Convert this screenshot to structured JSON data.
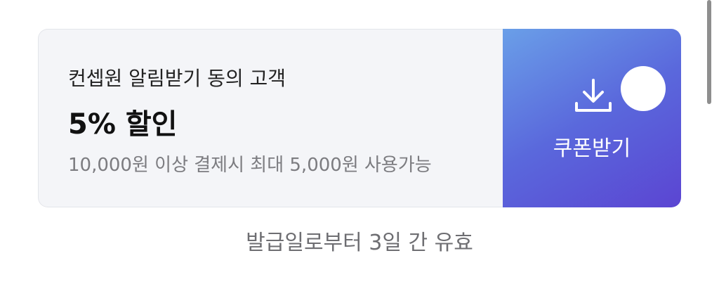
{
  "coupon": {
    "condition": "컨셉원 알림받기 동의 고객",
    "discount": "5% 할인",
    "detail": "10,000원 이상 결제시 최대 5,000원 사용가능",
    "action_label": "쿠폰받기",
    "action_icon": "download-icon",
    "validity": "발급일로부터 3일 간 유효"
  },
  "colors": {
    "action_gradient_start": "#6a9fe8",
    "action_gradient_end": "#5b45d2",
    "card_background": "#f4f5f8"
  }
}
